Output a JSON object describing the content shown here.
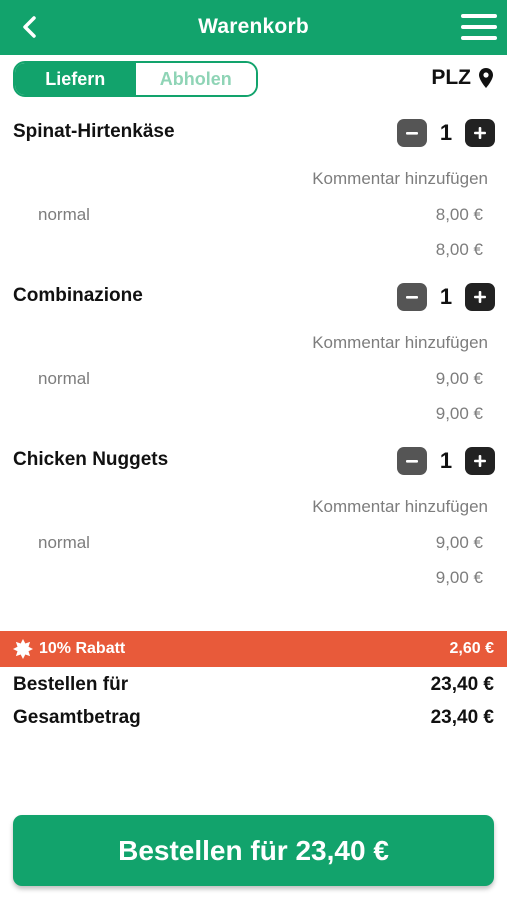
{
  "header": {
    "title": "Warenkorb"
  },
  "mode": {
    "deliver_label": "Liefern",
    "pickup_label": "Abholen",
    "selected": "Liefern"
  },
  "location": {
    "label": "PLZ"
  },
  "cart": {
    "items": [
      {
        "name": "Spinat-Hirtenkäse",
        "quantity": "1",
        "comment_label": "Kommentar hinzufügen",
        "variant": "normal",
        "unit_price": "8,00 €",
        "line_total": "8,00 €"
      },
      {
        "name": "Combinazione",
        "quantity": "1",
        "comment_label": "Kommentar hinzufügen",
        "variant": "normal",
        "unit_price": "9,00 €",
        "line_total": "9,00 €"
      },
      {
        "name": "Chicken Nuggets",
        "quantity": "1",
        "comment_label": "Kommentar hinzufügen",
        "variant": "normal",
        "unit_price": "9,00 €",
        "line_total": "9,00 €"
      }
    ]
  },
  "discount": {
    "label": "10% Rabatt",
    "amount": "2,60 €"
  },
  "summary": {
    "order_for_label": "Bestellen für",
    "order_for_value": "23,40 €",
    "total_label": "Gesamtbetrag",
    "total_value": "23,40 €"
  },
  "order_button": {
    "label": "Bestellen für 23,40 €"
  },
  "icons": {
    "back": "chevron-left-icon",
    "menu": "hamburger-menu-icon",
    "location": "map-pin-icon",
    "minus": "minus-icon",
    "plus": "plus-icon",
    "discount": "badge-icon"
  },
  "colors": {
    "brand": "#12a36c",
    "discount": "#e85a3a",
    "muted_text": "#7d7d7d",
    "inactive_toggle_text": "#8fd4b6"
  }
}
